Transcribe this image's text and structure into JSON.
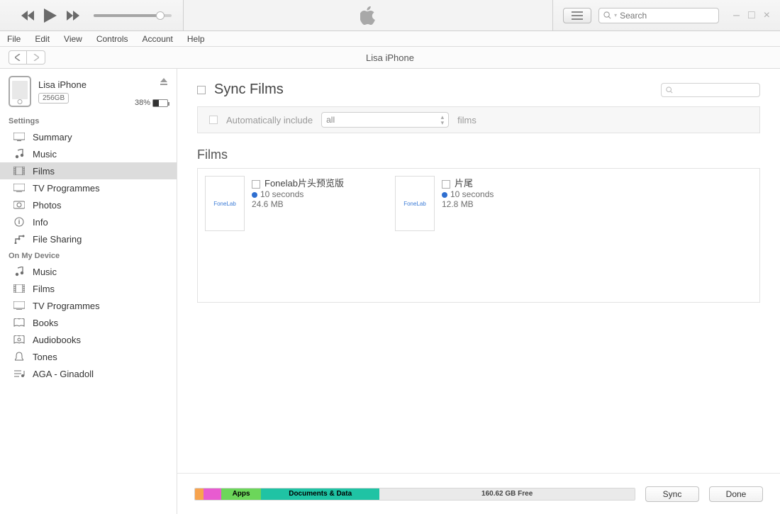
{
  "window_controls": {
    "min": "–",
    "max": "□",
    "close": "×"
  },
  "toolbar": {
    "volume_pct": 85,
    "search_placeholder": "Search"
  },
  "menubar": [
    "File",
    "Edit",
    "View",
    "Controls",
    "Account",
    "Help"
  ],
  "nav": {
    "title": "Lisa iPhone"
  },
  "device": {
    "name": "Lisa iPhone",
    "capacity": "256GB",
    "battery_pct": "38%",
    "battery_fill": 38
  },
  "sidebar": {
    "settings_header": "Settings",
    "settings": [
      {
        "id": "summary",
        "label": "Summary",
        "icon": "summary"
      },
      {
        "id": "music",
        "label": "Music",
        "icon": "music"
      },
      {
        "id": "films",
        "label": "Films",
        "icon": "films",
        "selected": true
      },
      {
        "id": "tv",
        "label": "TV Programmes",
        "icon": "tv"
      },
      {
        "id": "photos",
        "label": "Photos",
        "icon": "photos"
      },
      {
        "id": "info",
        "label": "Info",
        "icon": "info"
      },
      {
        "id": "filesharing",
        "label": "File Sharing",
        "icon": "filesharing"
      }
    ],
    "device_header": "On My Device",
    "device_items": [
      {
        "id": "d-music",
        "label": "Music",
        "icon": "music"
      },
      {
        "id": "d-films",
        "label": "Films",
        "icon": "films"
      },
      {
        "id": "d-tv",
        "label": "TV Programmes",
        "icon": "tv"
      },
      {
        "id": "d-books",
        "label": "Books",
        "icon": "books"
      },
      {
        "id": "d-audiob",
        "label": "Audiobooks",
        "icon": "audiobooks"
      },
      {
        "id": "d-tones",
        "label": "Tones",
        "icon": "tones"
      },
      {
        "id": "d-aga",
        "label": "AGA - Ginadoll",
        "icon": "playlist"
      }
    ]
  },
  "main": {
    "sync_title": "Sync Films",
    "auto_label": "Automatically include",
    "auto_select": "all",
    "auto_suffix": "films",
    "films_header": "Films",
    "films": [
      {
        "title": "Fonelab片头预览版",
        "duration": "10 seconds",
        "size": "24.6 MB",
        "thumb": "FoneLab"
      },
      {
        "title": "片尾",
        "duration": "10 seconds",
        "size": "12.8 MB",
        "thumb": "FoneLab"
      }
    ]
  },
  "footer": {
    "segments": [
      {
        "cls": "audio",
        "label": "",
        "width": 2
      },
      {
        "cls": "photos",
        "label": "",
        "width": 4
      },
      {
        "cls": "apps",
        "label": "Apps",
        "width": 9
      },
      {
        "cls": "docs",
        "label": "Documents & Data",
        "width": 27
      },
      {
        "cls": "free",
        "label": "160.62 GB Free",
        "width": 58
      }
    ],
    "sync": "Sync",
    "done": "Done"
  }
}
